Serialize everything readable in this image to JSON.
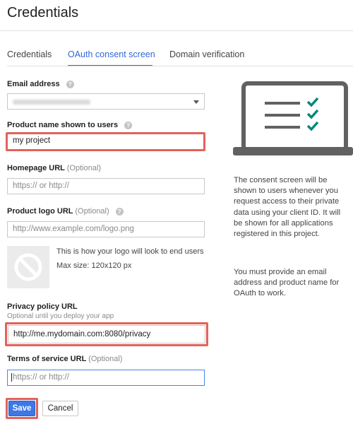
{
  "header": {
    "title": "Credentials"
  },
  "tabs": [
    {
      "label": "Credentials",
      "active": false
    },
    {
      "label": "OAuth consent screen",
      "active": true
    },
    {
      "label": "Domain verification",
      "active": false
    }
  ],
  "form": {
    "email": {
      "label": "Email address"
    },
    "product_name": {
      "label": "Product name shown to users",
      "value": "my project"
    },
    "homepage": {
      "label": "Homepage URL",
      "optional": "(Optional)",
      "placeholder": "https:// or http://"
    },
    "logo": {
      "label": "Product logo URL",
      "optional": "(Optional)",
      "placeholder": "http://www.example.com/logo.png",
      "preview_note": "This is how your logo will look to end users",
      "max_size": "Max size: 120x120 px"
    },
    "privacy": {
      "label": "Privacy policy URL",
      "sub_label": "Optional until you deploy your app",
      "value": "http://me.mydomain.com:8080/privacy"
    },
    "terms": {
      "label": "Terms of service URL",
      "optional": "(Optional)",
      "placeholder": "https:// or http://"
    }
  },
  "buttons": {
    "save": "Save",
    "cancel": "Cancel"
  },
  "side_panel": {
    "paragraph1": "The consent screen will be shown to users whenever you request access to their private data using your client ID. It will be shown for all applications registered in this project.",
    "paragraph2": "You must provide an email address and product name for OAuth to work."
  },
  "colors": {
    "accent": "#3367d6",
    "highlight": "#e2625b",
    "check": "#00897b",
    "save_button": "#3d78e6"
  },
  "icons": {
    "help": "question-mark-circle",
    "dropdown": "caret-down",
    "logo_placeholder": "circle-slash",
    "illustration": "laptop-with-checklist"
  }
}
